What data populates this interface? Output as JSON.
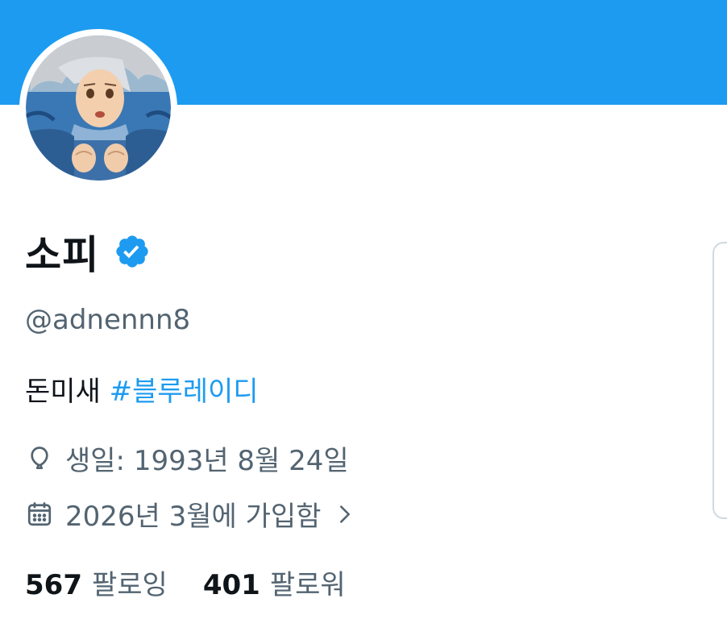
{
  "colors": {
    "banner": "#1d9bf0",
    "accent": "#1d9bf0",
    "text_primary": "#0f1419",
    "text_secondary": "#536471"
  },
  "profile": {
    "avatar_icon": "anime-character-avatar",
    "display_name": "소피",
    "verified_icon": "verified-badge-icon",
    "handle": "@adnennn8",
    "bio_text": "돈미새",
    "bio_hashtag": "#블루레이디"
  },
  "meta": {
    "birthday_icon": "balloon-icon",
    "birthday": "생일: 1993년 8월 24일",
    "joined_icon": "calendar-icon",
    "joined": "2026년 3월에 가입함",
    "joined_chevron_icon": "chevron-right-icon"
  },
  "stats": {
    "following_count": "567",
    "following_label": "팔로잉",
    "followers_count": "401",
    "followers_label": "팔로워"
  }
}
